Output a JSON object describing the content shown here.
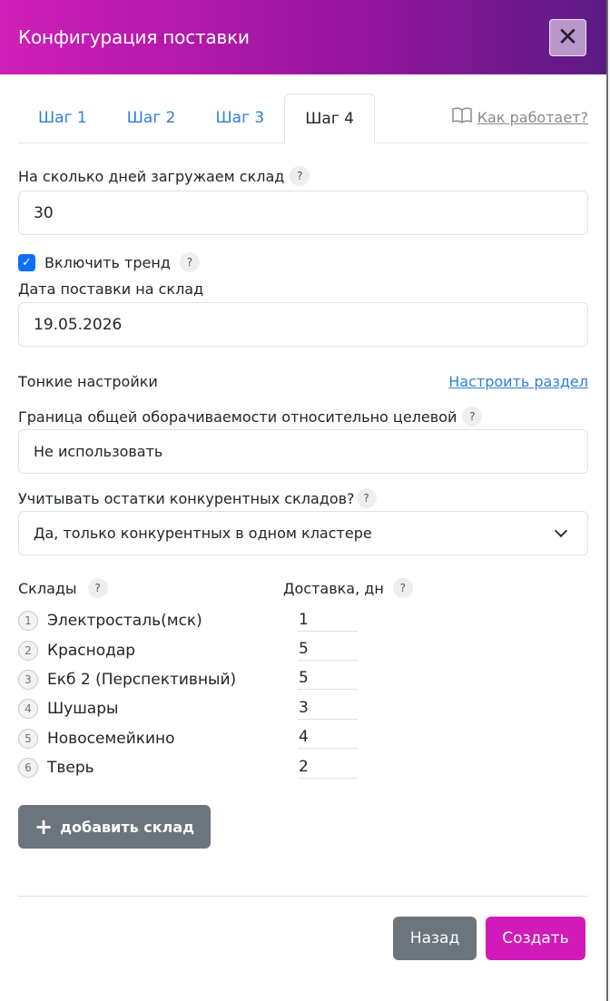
{
  "header": {
    "title": "Конфигурация поставки"
  },
  "tabs": [
    {
      "label": "Шаг 1"
    },
    {
      "label": "Шаг 2"
    },
    {
      "label": "Шаг 3"
    },
    {
      "label": "Шаг 4"
    }
  ],
  "how_link": {
    "label": "Как работает?",
    "icon": "book-icon"
  },
  "days": {
    "label": "На сколько дней загружаем склад",
    "value": "30"
  },
  "trend": {
    "label": "Включить тренд",
    "checked": true
  },
  "delivery_date": {
    "label": "Дата поставки на склад",
    "value": "19.05.2026"
  },
  "fine": {
    "label": "Тонкие настройки",
    "link": "Настроить раздел"
  },
  "turnover": {
    "label": "Граница общей оборачиваемости относительно целевой",
    "value": "Не использовать"
  },
  "competitors": {
    "label": "Учитывать остатки конкурентных складов?",
    "value": "Да, только конкурентных в одном кластере"
  },
  "warehouses": {
    "col_name": "Склады",
    "col_days": "Доставка, дн",
    "rows": [
      {
        "num": "1",
        "name": "Электросталь(мск)",
        "days": "1"
      },
      {
        "num": "2",
        "name": "Краснодар",
        "days": "5"
      },
      {
        "num": "3",
        "name": "Екб 2 (Перспективный)",
        "days": "5"
      },
      {
        "num": "4",
        "name": "Шушары",
        "days": "3"
      },
      {
        "num": "5",
        "name": "Новосемейкино",
        "days": "4"
      },
      {
        "num": "6",
        "name": "Тверь",
        "days": "2"
      }
    ],
    "add_label": "добавить склад"
  },
  "footer": {
    "back_label": "Назад",
    "create_label": "Создать"
  },
  "help_glyph": "?",
  "colors": {
    "accent": "#d21ab8",
    "link": "#2f7fd6",
    "secondary": "#6c757d"
  }
}
